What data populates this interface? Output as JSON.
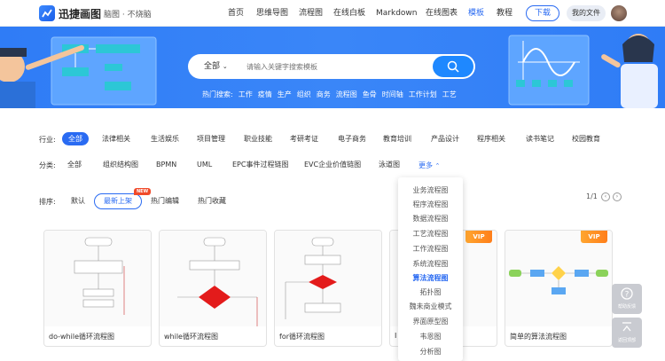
{
  "header": {
    "brand": "迅捷画图",
    "brand_sub": "脑图 · 不烧脑",
    "nav": [
      "首页",
      "思维导图",
      "流程图",
      "在线白板",
      "Markdown",
      "在线图表",
      "模板",
      "教程"
    ],
    "nav_active": "模板",
    "download_label": "下载",
    "my_files_label": "我的文件"
  },
  "search": {
    "category": "全部",
    "placeholder": "请输入关键字搜索模板",
    "hot_label": "热门搜索:",
    "hot_terms": [
      "工作",
      "疫情",
      "生产",
      "组织",
      "商务",
      "流程图",
      "鱼骨",
      "时间轴",
      "工作计划",
      "工艺"
    ]
  },
  "filters": {
    "industry_label": "行业:",
    "industries": [
      "全部",
      "法律相关",
      "生活娱乐",
      "项目管理",
      "职业技能",
      "考研考证",
      "电子商务",
      "教育培训",
      "产品设计",
      "程序相关",
      "读书笔记",
      "校园教育"
    ],
    "industry_selected": "全部",
    "category_label": "分类:",
    "categories": [
      "全部",
      "组织结构图",
      "BPMN",
      "UML",
      "EPC事件过程链图",
      "EVC企业价值链图",
      "泳道图"
    ],
    "more_label": "更多",
    "sort_label": "排序:",
    "sorts": [
      "默认",
      "最新上架",
      "热门编辑",
      "热门收藏"
    ],
    "sort_selected": "最新上架",
    "new_badge": "NEW",
    "page_indicator": "1/1"
  },
  "dropdown_items": [
    "业务流程图",
    "程序流程图",
    "数据流程图",
    "工艺流程图",
    "工作流程图",
    "系统流程图",
    "算法流程图",
    "拓扑图",
    "魏未商业模式",
    "界面原型图",
    "韦恩图",
    "分析图"
  ],
  "dropdown_active": "算法流程图",
  "cards": [
    {
      "title": "do-while循环流程图",
      "vip": false
    },
    {
      "title": "while循环流程图",
      "vip": false
    },
    {
      "title": "for循环流程图",
      "vip": false
    },
    {
      "title": "I",
      "vip": true
    },
    {
      "title": "简单的算法流程图",
      "vip": true
    }
  ],
  "vip_label": "VIP",
  "side_tools": [
    "帮助反馈",
    "返回顶部"
  ],
  "colors": {
    "primary": "#2a6bf2",
    "banner": "#3a86f8",
    "vip": "#ff8c1f"
  }
}
